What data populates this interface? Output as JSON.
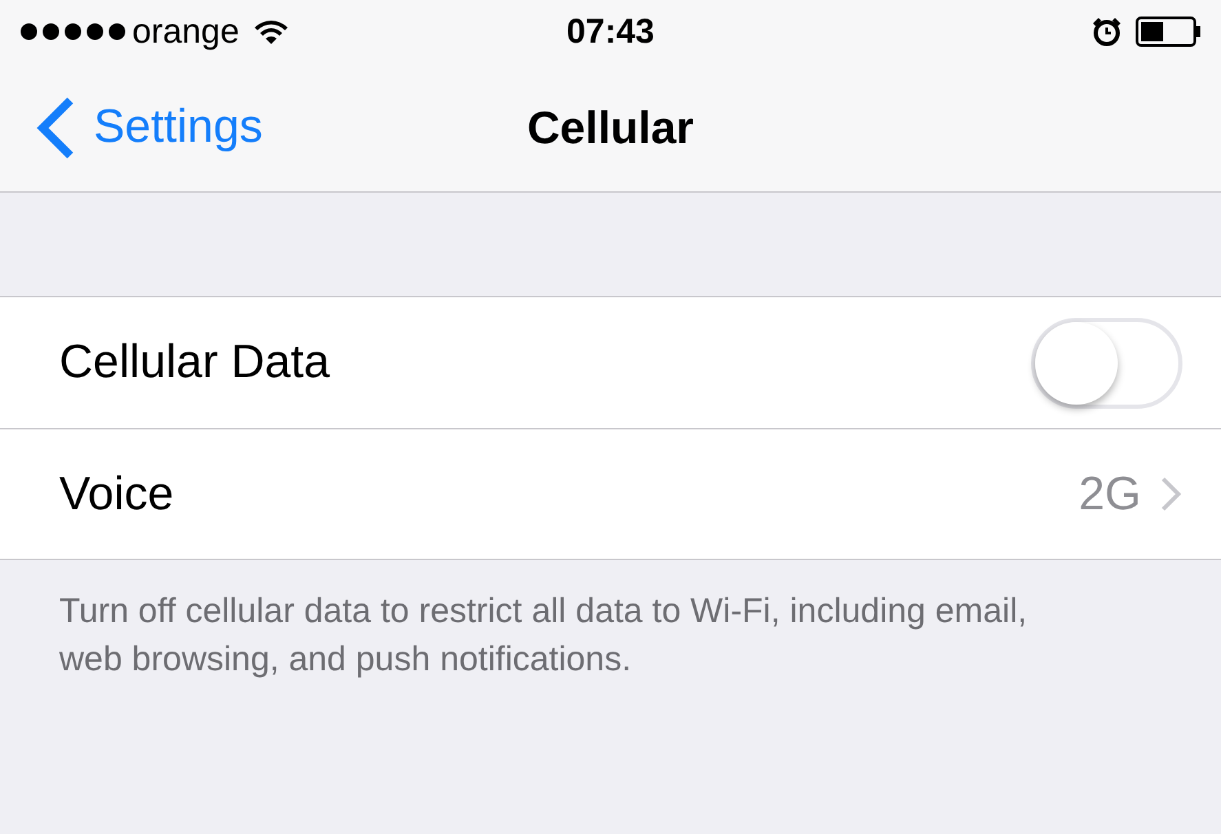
{
  "status_bar": {
    "carrier": "orange",
    "time": "07:43"
  },
  "nav_bar": {
    "back": "Settings",
    "title": "Cellular"
  },
  "rows": [
    {
      "kind": "toggle",
      "label": "Cellular Data",
      "on": false
    },
    {
      "kind": "link",
      "label": "Voice",
      "value": "2G"
    }
  ],
  "footer": "Turn off cellular data to restrict all data to Wi-Fi, including email, web browsing, and push notifications."
}
